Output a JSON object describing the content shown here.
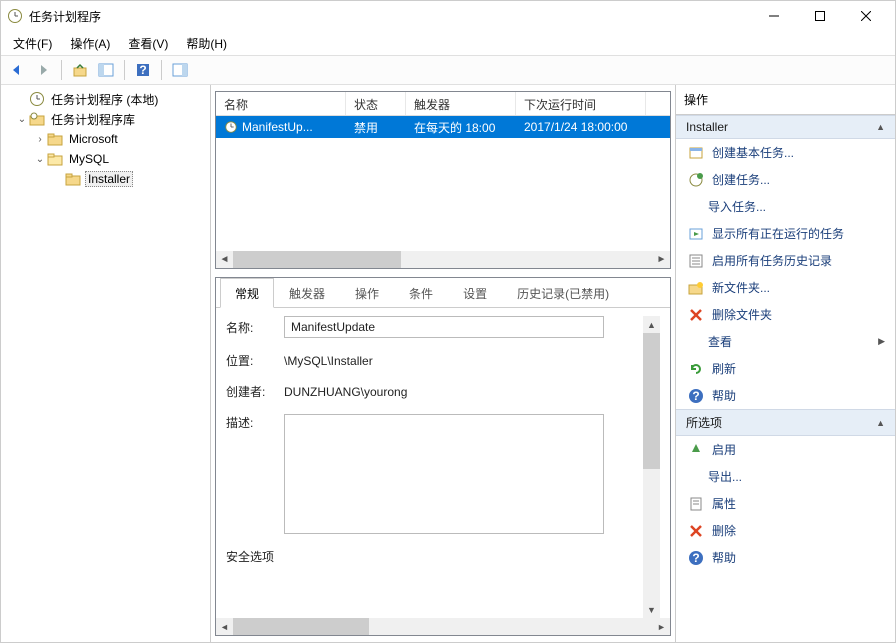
{
  "window": {
    "title": "任务计划程序"
  },
  "menu": {
    "file": "文件(F)",
    "action": "操作(A)",
    "view": "查看(V)",
    "help": "帮助(H)"
  },
  "tree": {
    "root": "任务计划程序 (本地)",
    "lib": "任务计划程序库",
    "microsoft": "Microsoft",
    "mysql": "MySQL",
    "installer": "Installer"
  },
  "list": {
    "cols": {
      "name": "名称",
      "status": "状态",
      "trigger": "触发器",
      "next": "下次运行时间"
    },
    "row": {
      "name": "ManifestUp...",
      "status": "禁用",
      "trigger": "在每天的 18:00",
      "next": "2017/1/24 18:00:00"
    }
  },
  "tabs": {
    "general": "常规",
    "triggers": "触发器",
    "actions": "操作",
    "conditions": "条件",
    "settings": "设置",
    "history": "历史记录(已禁用)"
  },
  "detail": {
    "name_label": "名称:",
    "name_value": "ManifestUpdate",
    "loc_label": "位置:",
    "loc_value": "\\MySQL\\Installer",
    "author_label": "创建者:",
    "author_value": "DUNZHUANG\\yourong",
    "desc_label": "描述:",
    "cutoff": "安全选项"
  },
  "actions": {
    "header": "操作",
    "section1": "Installer",
    "items1": {
      "create_basic": "创建基本任务...",
      "create": "创建任务...",
      "import": "导入任务...",
      "show_running": "显示所有正在运行的任务",
      "enable_history": "启用所有任务历史记录",
      "new_folder": "新文件夹...",
      "delete_folder": "删除文件夹",
      "view": "查看",
      "refresh": "刷新",
      "help": "帮助"
    },
    "section2": "所选项",
    "items2": {
      "enable": "启用",
      "export": "导出...",
      "properties": "属性",
      "delete": "删除",
      "help": "帮助"
    }
  }
}
